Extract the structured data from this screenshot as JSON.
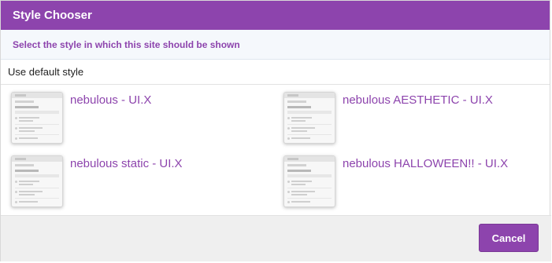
{
  "dialog": {
    "title": "Style Chooser",
    "subtitle": "Select the style in which this site should be shown",
    "default_option": "Use default style",
    "styles": [
      {
        "label": "nebulous - UI.X"
      },
      {
        "label": "nebulous AESTHETIC - UI.X"
      },
      {
        "label": "nebulous static - UI.X"
      },
      {
        "label": "nebulous HALLOWEEN!! - UI.X"
      }
    ],
    "cancel_label": "Cancel"
  },
  "colors": {
    "accent": "#8d44ad",
    "subtitle_bg": "#f5f8fc",
    "footer_bg": "#efefef"
  }
}
